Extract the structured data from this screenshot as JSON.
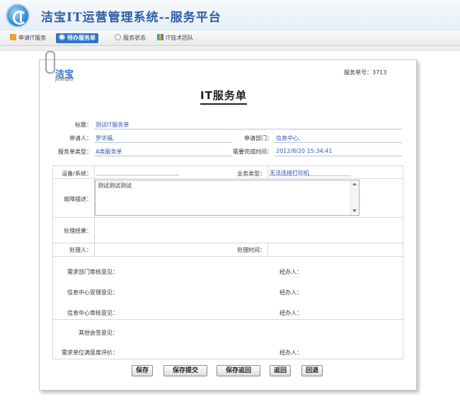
{
  "header": {
    "title": "洁宝IT运营管理系统--服务平台"
  },
  "nav": {
    "items": [
      {
        "label": "申请IT服务"
      },
      {
        "label": "待办服务单"
      },
      {
        "label": "服务状态"
      },
      {
        "label": "IT技术团队"
      }
    ]
  },
  "form": {
    "brand": "洁宝",
    "brand_sub": "jeanper",
    "ticket_no": "服务单号：3713",
    "title": "IT服务单",
    "fields": {
      "title_label": "标题：",
      "title_value": "测试IT服务单",
      "applicant_label": "申请人：",
      "applicant_value": "罗华福,",
      "dept_label": "申请部门：",
      "dept_value": "信息中心,",
      "type_label": "服务单类型：",
      "type_value": "A类服务单",
      "due_label": "需要完成时间：",
      "due_value": "2012/8/20 15:34:41",
      "device_label": "设备/系统：",
      "device_value": "",
      "biz_label": "业务类型：",
      "biz_value": "无法连接打印机",
      "fault_label": "故障描述：",
      "fault_value": "测试测试测试",
      "result_label": "处理结果：",
      "handler_label": "处理人：",
      "handle_time_label": "处理时间："
    },
    "reviews": [
      {
        "label": "需求部门审核意见：",
        "agent": "经办人："
      },
      {
        "label": "信息中心受理意见：",
        "agent": ""
      },
      {
        "label": "信息中心审核意见：",
        "agent": "经办人："
      },
      {
        "label": "其他会签意见：",
        "agent": ""
      },
      {
        "label": "需求单位满意度评价：",
        "agent": "经办人："
      }
    ],
    "review_agent_2": "经办人："
  },
  "buttons": {
    "save": "保存",
    "save_submit": "保存提交",
    "save_return": "保存返回",
    "return": "返回",
    "rollback": "回退"
  }
}
